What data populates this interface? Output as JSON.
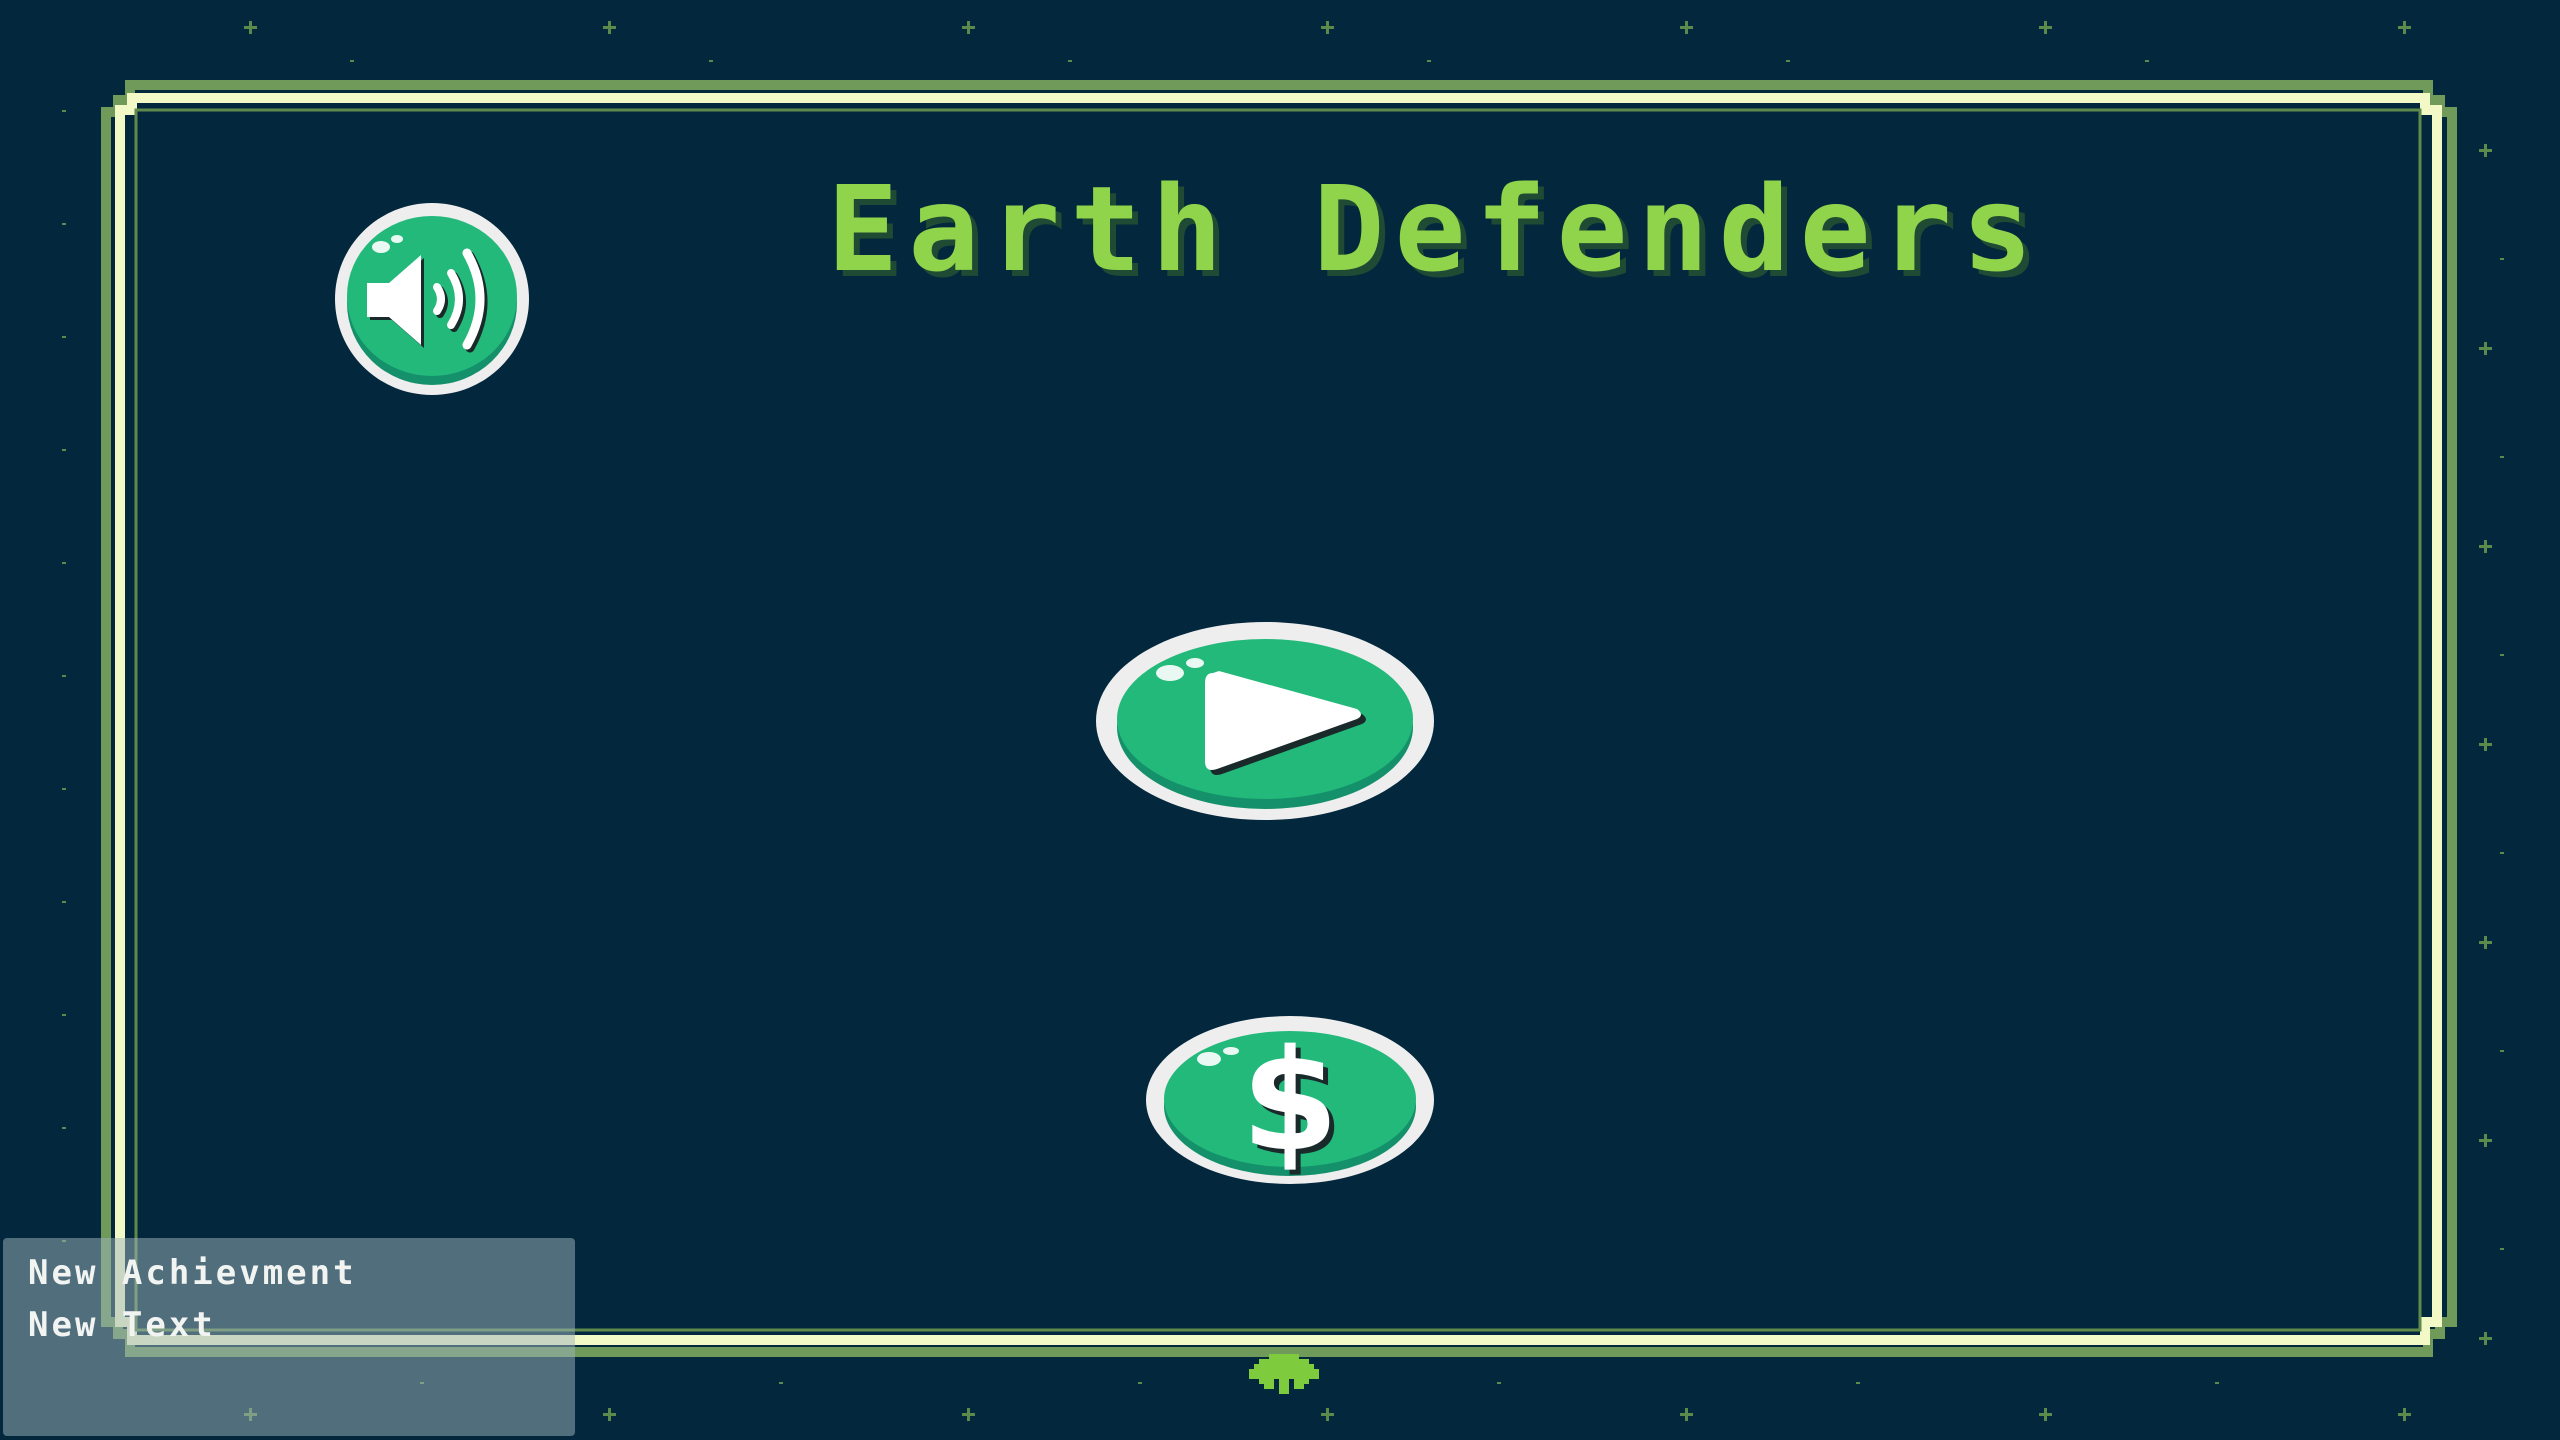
{
  "game": {
    "title": "Earth Defenders"
  },
  "buttons": {
    "sound": {
      "icon": "speaker-volume-icon"
    },
    "play": {
      "icon": "play-triangle-icon"
    },
    "shop": {
      "icon": "dollar-sign-icon",
      "symbol": "$"
    }
  },
  "achievement": {
    "title": "New Achievment",
    "text": "New Text"
  },
  "colors": {
    "background": "#03283d",
    "title": "#8fd44a",
    "frame_outer": "#6f9a5a",
    "frame_inner": "#f2f8c6",
    "button_face": "#22b97a",
    "button_rim": "#eeeeee",
    "invader": "#7ecb3d"
  }
}
